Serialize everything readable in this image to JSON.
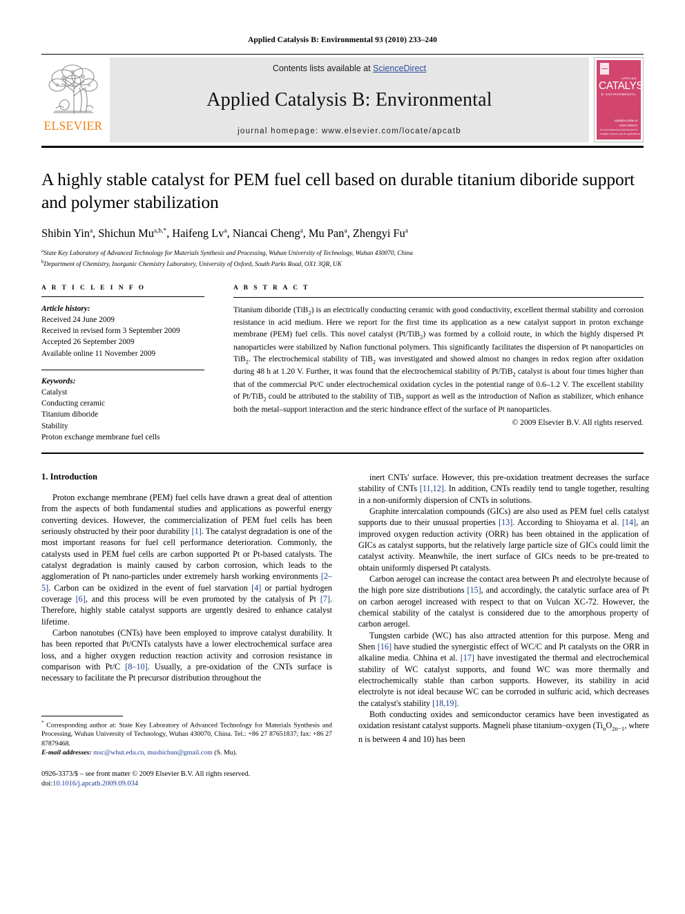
{
  "running_head": "Applied Catalysis B: Environmental 93 (2010) 233–240",
  "masthead": {
    "contents_prefix": "Contents lists available at ",
    "sciencedirect": "ScienceDirect",
    "journal_name": "Applied Catalysis B: Environmental",
    "homepage": "journal homepage: www.elsevier.com/locate/apcatb",
    "publisher_wordmark": "ELSEVIER",
    "cover": {
      "applied": "APPLIED",
      "title": "CATALYSIS",
      "subtitle": "B: ENVIRONMENTAL",
      "sciencedirect_note": "Available online at\nScienceDirect",
      "bottom_note": "An international journal devoted to\ncatalytic science and its applications"
    },
    "accent_link_color": "#2f4da0",
    "elsevier_orange": "#F07F13",
    "cover_pink": "#d1456f"
  },
  "title": "A highly stable catalyst for PEM fuel cell based on durable titanium diboride support and polymer stabilization",
  "authors_html": "Shibin Yin<sup>a</sup>, Shichun Mu<sup>a,b,*</sup>, Haifeng Lv<sup>a</sup>, Niancai Cheng<sup>a</sup>, Mu Pan<sup>a</sup>, Zhengyi Fu<sup>a</sup>",
  "affiliations": [
    {
      "mark": "a",
      "text": "State Key Laboratory of Advanced Technology for Materials Synthesis and Processing, Wuhan University of Technology, Wuhan 430070, China"
    },
    {
      "mark": "b",
      "text": "Department of Chemistry, Inorganic Chemistry Laboratory, University of Oxford, South Parks Road, OX1 3QR, UK"
    }
  ],
  "article_info": {
    "heading": "A R T I C L E   I N F O",
    "history_label": "Article history:",
    "history": [
      "Received 24 June 2009",
      "Received in revised form 3 September 2009",
      "Accepted 26 September 2009",
      "Available online 11 November 2009"
    ],
    "keywords_label": "Keywords:",
    "keywords": [
      "Catalyst",
      "Conducting ceramic",
      "Titanium diboride",
      "Stability",
      "Proton exchange membrane fuel cells"
    ]
  },
  "abstract": {
    "heading": "A B S T R A C T",
    "text_html": "Titanium diboride (TiB<sub>2</sub>) is an electrically conducting ceramic with good conductivity, excellent thermal stability and corrosion resistance in acid medium. Here we report for the first time its application as a new catalyst support in proton exchange membrane (PEM) fuel cells. This novel catalyst (Pt/TiB<sub>2</sub>) was formed by a colloid route, in which the highly dispersed Pt nanoparticles were stabilized by Nafion functional polymers. This significantly facilitates the dispersion of Pt nanoparticles on TiB<sub>2</sub>. The electrochemical stability of TiB<sub>2</sub> was investigated and showed almost no changes in redox region after oxidation during 48 h at 1.20 V. Further, it was found that the electrochemical stability of Pt/TiB<sub>2</sub> catalyst is about four times higher than that of the commercial Pt/C under electrochemical oxidation cycles in the potential range of 0.6–1.2 V. The excellent stability of Pt/TiB<sub>2</sub> could be attributed to the stability of TiB<sub>2</sub> support as well as the introduction of Nafion as stabilizer, which enhance both the metal–support interaction and the steric hindrance effect of the surface of Pt nanoparticles.",
    "copyright": "© 2009 Elsevier B.V. All rights reserved."
  },
  "body": {
    "section_heading": "1. Introduction",
    "left_paragraphs_html": [
      "Proton exchange membrane (PEM) fuel cells have drawn a great deal of attention from the aspects of both fundamental studies and applications as powerful energy converting devices. However, the commercialization of PEM fuel cells has been seriously obstructed by their poor durability <span class=\"ref\">[1]</span>. The catalyst degradation is one of the most important reasons for fuel cell performance deterioration. Commonly, the catalysts used in PEM fuel cells are carbon supported Pt or Pt-based catalysts. The catalyst degradation is mainly caused by carbon corrosion, which leads to the agglomeration of Pt nano-particles under extremely harsh working environments <span class=\"ref\">[2–5]</span>. Carbon can be oxidized in the event of fuel starvation <span class=\"ref\">[4]</span> or partial hydrogen coverage <span class=\"ref\">[6]</span>, and this process will be even promoted by the catalysis of Pt <span class=\"ref\">[7]</span>. Therefore, highly stable catalyst supports are urgently desired to enhance catalyst lifetime.",
      "Carbon nanotubes (CNTs) have been employed to improve catalyst durability. It has been reported that Pt/CNTs catalysts have a lower electrochemical surface area loss, and a higher oxygen reduction reaction activity and corrosion resistance in comparison with Pt/C <span class=\"ref\">[8–10]</span>. Usually, a pre-oxidation of the CNTs surface is necessary to facilitate the Pt precursor distribution throughout the"
    ],
    "right_paragraphs_html": [
      "inert CNTs' surface. However, this pre-oxidation treatment decreases the surface stability of CNTs <span class=\"ref\">[11,12]</span>. In addition, CNTs readily tend to tangle together, resulting in a non-uniformly dispersion of CNTs in solutions.",
      "Graphite intercalation compounds (GICs) are also used as PEM fuel cells catalyst supports due to their unusual properties <span class=\"ref\">[13]</span>. According to Shioyama et al. <span class=\"ref\">[14]</span>, an improved oxygen reduction activity (ORR) has been obtained in the application of GICs as catalyst supports, but the relatively large particle size of GICs could limit the catalyst activity. Meanwhile, the inert surface of GICs needs to be pre-treated to obtain uniformly dispersed Pt catalysts.",
      "Carbon aerogel can increase the contact area between Pt and electrolyte because of the high pore size distributions <span class=\"ref\">[15]</span>, and accordingly, the catalytic surface area of Pt on carbon aerogel increased with respect to that on Vulcan XC-72. However, the chemical stability of the catalyst is considered due to the amorphous property of carbon aerogel.",
      "Tungsten carbide (WC) has also attracted attention for this purpose. Meng and Shen <span class=\"ref\">[16]</span> have studied the synergistic effect of WC/C and Pt catalysts on the ORR in alkaline media. Chhina et al. <span class=\"ref\">[17]</span> have investigated the thermal and electrochemical stability of WC catalyst supports, and found WC was more thermally and electrochemically stable than carbon supports. However, its stability in acid electrolyte is not ideal because WC can be corroded in sulfuric acid, which decreases the catalyst's stability <span class=\"ref\">[18,19]</span>.",
      "Both conducting oxides and semiconductor ceramics have been investigated as oxidation resistant catalyst supports. Magneli phase titanium–oxygen (Ti<sub>n</sub>O<sub>2n−1</sub>, where n is between 4 and 10) has been"
    ]
  },
  "footnote": {
    "corresponding_html": "<sup>*</sup> Corresponding author at: State Key Laboratory of Advanced Technology for Materials Synthesis and Processing, Wuhan University of Technology, Wuhan 430070, China. Tel.: +86 27 87651837; fax: +86 27 87879468.",
    "email_label": "E-mail addresses:",
    "emails": "msc@whut.edu.cn, mushichun@gmail.com",
    "email_suffix": "(S. Mu)."
  },
  "issn": {
    "line1_html": "0926-3373/$ – see front matter © 2009 Elsevier B.V. All rights reserved.",
    "doi_label": "doi:",
    "doi_value": "10.1016/j.apcatb.2009.09.034"
  }
}
